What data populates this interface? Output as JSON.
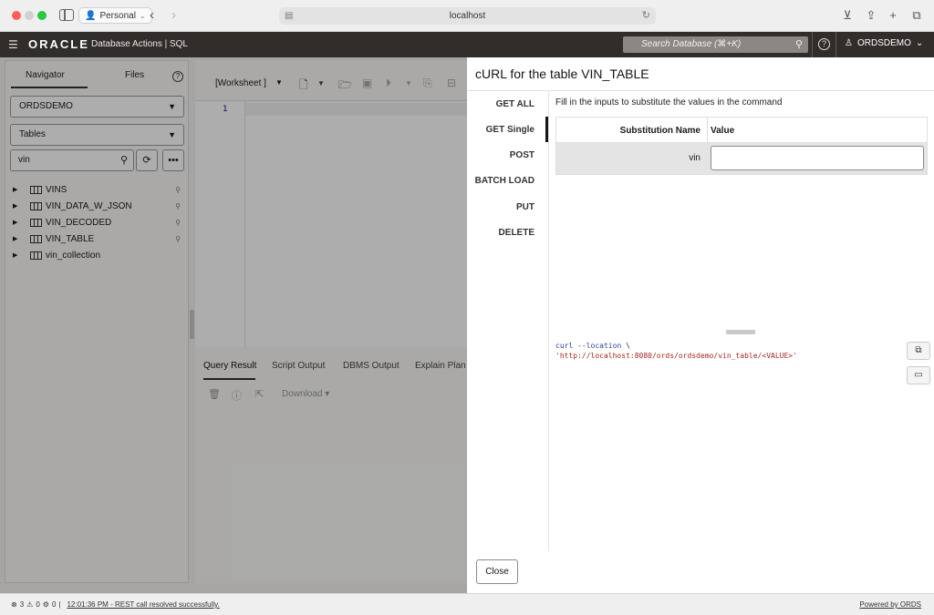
{
  "browser": {
    "profile": "Personal",
    "url": "localhost"
  },
  "app": {
    "logo": "ORACLE",
    "title": "Database Actions | SQL",
    "search_placeholder": "Search Database (⌘+K)",
    "help": "?",
    "user": "ORDSDEMO"
  },
  "navigator": {
    "tabs": [
      "Navigator",
      "Files"
    ],
    "schema": "ORDSDEMO",
    "object_type": "Tables",
    "filter_value": "vin",
    "items": [
      {
        "label": "VINS"
      },
      {
        "label": "VIN_DATA_W_JSON"
      },
      {
        "label": "VIN_DECODED"
      },
      {
        "label": "VIN_TABLE"
      },
      {
        "label": "vin_collection"
      }
    ]
  },
  "worksheet": {
    "label": "[Worksheet ]",
    "line_number": "1",
    "result_tabs": [
      "Query Result",
      "Script Output",
      "DBMS Output",
      "Explain Plan"
    ],
    "download_label": "Download"
  },
  "panel": {
    "title": "cURL for the table VIN_TABLE",
    "methods": [
      "GET ALL",
      "GET Single",
      "POST",
      "BATCH LOAD",
      "PUT",
      "DELETE"
    ],
    "active_method": "GET Single",
    "instruction": "Fill in the inputs to substitute the values in the command",
    "table_headers": [
      "Substitution Name",
      "Value"
    ],
    "rows": [
      {
        "name": "vin",
        "value": ""
      }
    ],
    "code": {
      "cmd": "curl",
      "flag": "--location",
      "cont": "\\",
      "url": "'http://localhost:8080/ords/ordsdemo/vin_table/<VALUE>'"
    },
    "close_label": "Close"
  },
  "status": {
    "errors": "3",
    "warnings": "0",
    "tasks": "0",
    "message": "12:01:36 PM - REST call resolved successfully.",
    "powered_by": "Powered by ORDS"
  }
}
